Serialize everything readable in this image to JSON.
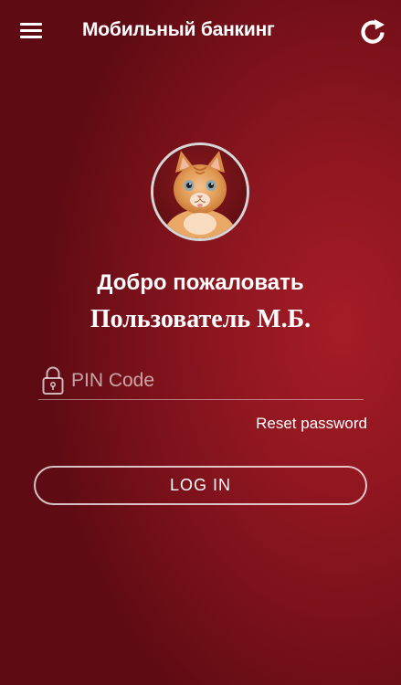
{
  "header": {
    "title": "Мобильный банкинг",
    "menu_icon": "hamburger-menu-icon",
    "refresh_icon": "refresh-icon"
  },
  "profile": {
    "avatar_icon": "user-avatar-kitten",
    "greeting": "Добро пожаловать",
    "user_name": "Пользователь М.Б."
  },
  "login_form": {
    "pin_icon": "lock-icon",
    "pin_placeholder": "PIN Code",
    "pin_value": "",
    "reset_password_label": "Reset password",
    "login_button_label": "LOG IN"
  },
  "colors": {
    "background": "#8e1620",
    "background_dark": "#5e0b13",
    "text": "#ffffff",
    "avatar_border": "#d6d6d6"
  }
}
